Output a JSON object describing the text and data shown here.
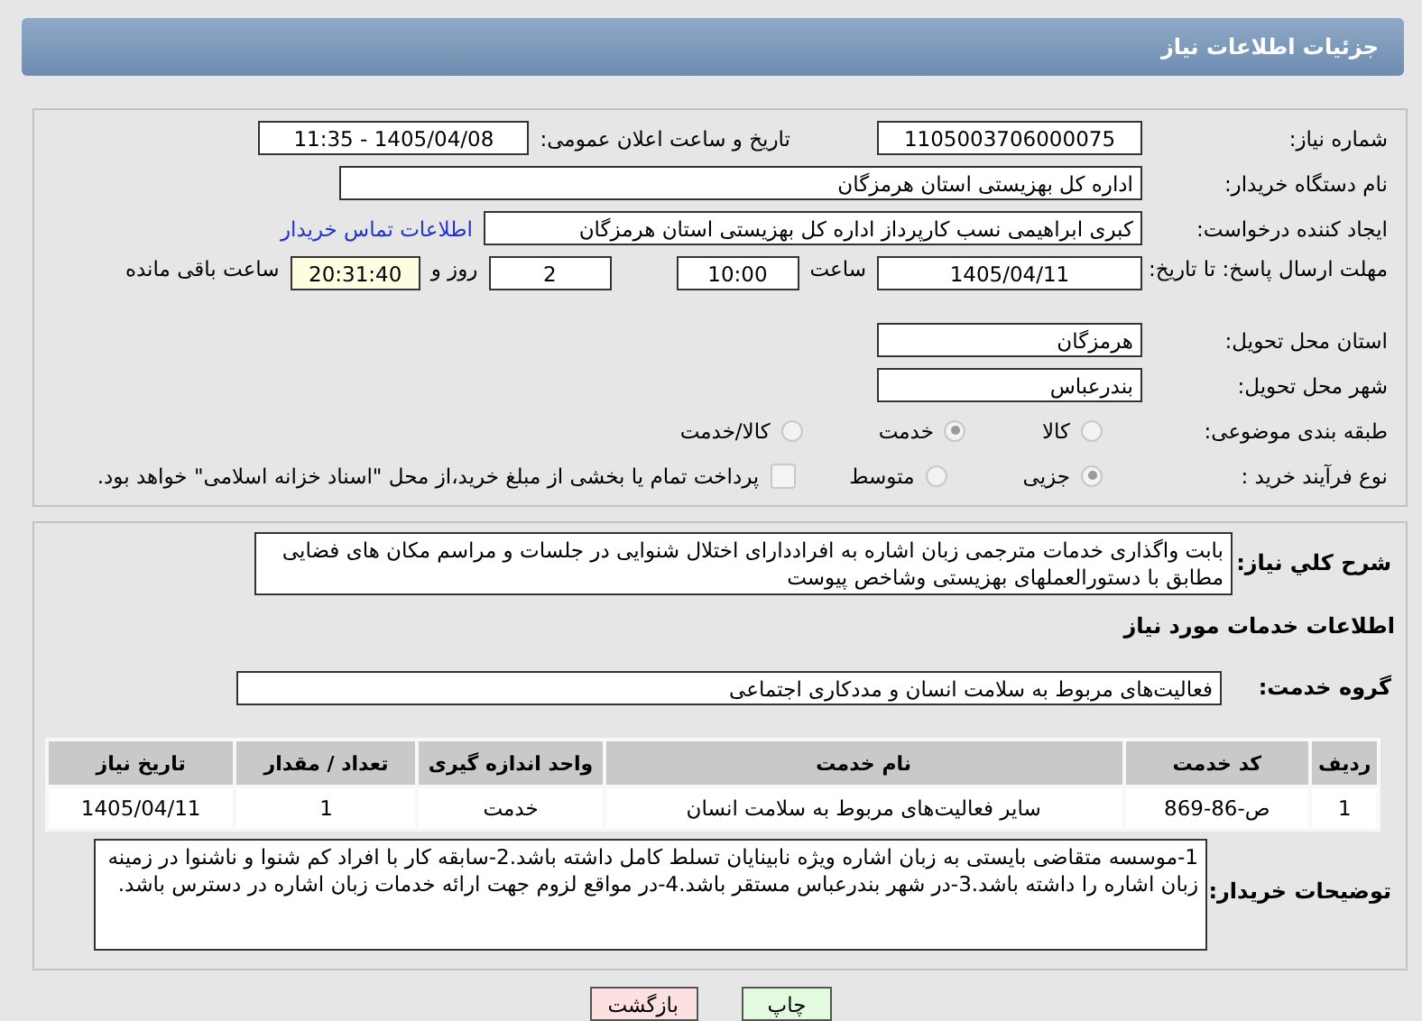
{
  "header": {
    "title": "جزئیات اطلاعات نیاز"
  },
  "need_number": {
    "label": "شماره نیاز:",
    "value": "1105003706000075"
  },
  "announce": {
    "label": "تاریخ و ساعت اعلان عمومی:",
    "value": "1405/04/08 - 11:35"
  },
  "buyer": {
    "label": "نام دستگاه خریدار:",
    "value": "اداره کل بهزیستی استان هرمزگان"
  },
  "creator": {
    "label": "ایجاد کننده درخواست:",
    "value": "کبری  ابراهیمی نسب کارپرداز اداره کل بهزیستی استان هرمزگان",
    "link": "اطلاعات تماس خریدار"
  },
  "deadline": {
    "label": "مهلت ارسال پاسخ: تا تاریخ:",
    "date": "1405/04/11",
    "time_label": "ساعت",
    "time": "10:00",
    "days": "2",
    "days_label": "روز و",
    "remaining": "20:31:40",
    "remaining_label": "ساعت باقی مانده"
  },
  "province": {
    "label": "استان محل تحویل:",
    "value": "هرمزگان"
  },
  "city": {
    "label": "شهر محل تحویل:",
    "value": "بندرعباس"
  },
  "category": {
    "label": "طبقه بندی موضوعی:",
    "options": [
      {
        "label": "کالا",
        "selected": false
      },
      {
        "label": "خدمت",
        "selected": true
      },
      {
        "label": "کالا/خدمت",
        "selected": false
      }
    ]
  },
  "process": {
    "label": "نوع فرآیند خرید :",
    "options": [
      {
        "label": "جزیی",
        "selected": true
      },
      {
        "label": "متوسط",
        "selected": false
      }
    ],
    "payment": {
      "label": "پرداخت تمام یا بخشی از مبلغ خرید،از محل \"اسناد خزانه اسلامی\" خواهد بود.",
      "checked": false
    }
  },
  "description": {
    "label": "شرح کلي نياز:",
    "value": "بابت واگذاری خدمات مترجمی زبان اشاره به افراددارای اختلال شنوایی در جلسات و مراسم مکان های فضایی مطابق با دستورالعملهای بهزیستی وشاخص پیوست"
  },
  "services_heading": "اطلاعات خدمات مورد نیاز",
  "service_group": {
    "label": "گروه خدمت:",
    "value": "فعالیت‌های مربوط به سلامت انسان و مددکاری اجتماعی"
  },
  "table": {
    "columns": [
      "ردیف",
      "کد خدمت",
      "نام خدمت",
      "واحد اندازه گیری",
      "تعداد / مقدار",
      "تاریخ نیاز"
    ],
    "rows": [
      [
        "1",
        "ص-86-869",
        "سایر فعالیت‌های مربوط به سلامت انسان",
        "خدمت",
        "1",
        "1405/04/11"
      ]
    ]
  },
  "notes": {
    "label": "توضیحات خریدار:",
    "value": "1-موسسه متقاضی بایستی به زبان اشاره ویژه نابینایان تسلط کامل داشته باشد.2-سابقه کار با افراد کم شنوا و ناشنوا در زمینه زبان اشاره را داشته باشد.3-در شهر بندرعباس مستقر باشد.4-در مواقع لزوم جهت ارائه خدمات زبان اشاره در دسترس باشد."
  },
  "buttons": [
    {
      "label": "چاپ",
      "kind": "print"
    },
    {
      "label": "بازگشت",
      "kind": "back"
    }
  ]
}
